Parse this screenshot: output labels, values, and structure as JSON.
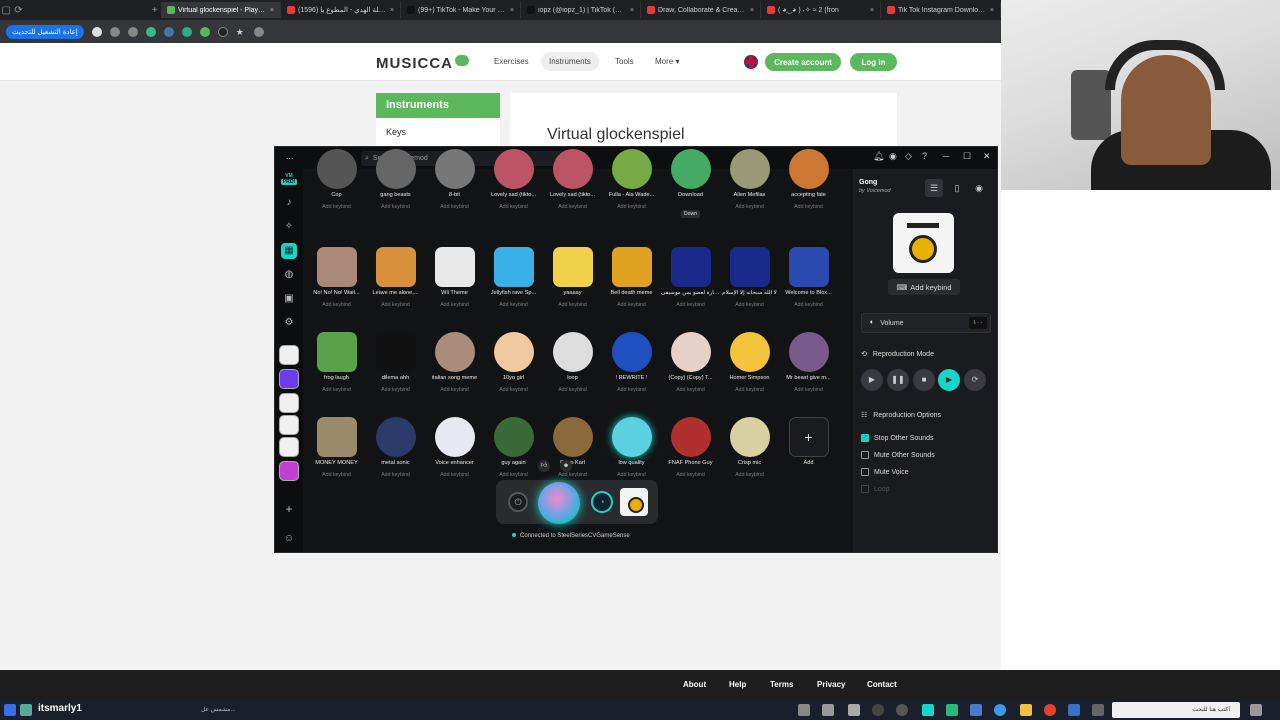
{
  "browser": {
    "tabs": [
      {
        "label": "Virtual glockenspiel - Play gloc",
        "active": true,
        "color": "#5cb85c"
      },
      {
        "label": "شيلة الهدي - المطوع يا (1596)",
        "active": false,
        "color": "#e53935"
      },
      {
        "label": "(99+) TikTok - Make Your Day",
        "active": false,
        "color": "#111111"
      },
      {
        "label": "iopz (@iopz_1) | TikTok (+99)",
        "active": false,
        "color": "#111111"
      },
      {
        "label": "Draw, Collaborate & Create wit",
        "active": false,
        "color": "#e53935"
      },
      {
        "label": "( ◕‿◕ ) ˖✧ ≈ 2 (fron",
        "active": false,
        "color": "#e53935"
      },
      {
        "label": "Tik Tok Instagram Downloade",
        "active": false,
        "color": "#e53935"
      }
    ],
    "reload_label": "إعادة التشغيل للتحديث"
  },
  "site": {
    "logo": "MUSICCA",
    "nav": {
      "exercises": "Exercises",
      "instruments": "Instruments",
      "tools": "Tools",
      "more": "More ▾"
    },
    "create_account": "Create account",
    "login": "Log in",
    "sidebar_heading": "Instruments",
    "sidebar_item": "Keys",
    "page_title": "Virtual glockenspiel",
    "footer": {
      "about": "About",
      "help": "Help",
      "terms": "Terms",
      "privacy": "Privacy",
      "contact": "Contact"
    }
  },
  "voicemod": {
    "menu": "...",
    "search_placeholder": "Search Voicemod",
    "pro_badge": "PRO!",
    "sounds": [
      {
        "name": "Cop",
        "keybind": "Add keybind",
        "color": "#555"
      },
      {
        "name": "gang beasts",
        "keybind": "Add keybind",
        "color": "#666"
      },
      {
        "name": "8-bit",
        "keybind": "Add keybind",
        "color": "#777"
      },
      {
        "name": "Lovely sad (tikto...",
        "keybind": "Add keybind",
        "color": "#b56"
      },
      {
        "name": "Lovely sad (tikto...",
        "keybind": "Add keybind",
        "color": "#b56"
      },
      {
        "name": "Fulla - Ala Wade...",
        "keybind": "Add keybind",
        "color": "#7a4"
      },
      {
        "name": "Download",
        "keybind": "Down",
        "color": "#4a6"
      },
      {
        "name": "Alien Mefilas",
        "keybind": "Add keybind",
        "color": "#997"
      },
      {
        "name": "accepting fate",
        "keybind": "Add keybind",
        "color": "#c73"
      },
      {
        "name": "No! No! No! Wait...",
        "keybind": "Add keybind",
        "color": "#a87"
      },
      {
        "name": "Leave me alone,...",
        "keybind": "Add keybind",
        "color": "#d8913a"
      },
      {
        "name": "Wii Theme",
        "keybind": "Add keybind",
        "color": "#e8e8e8"
      },
      {
        "name": "Jellyfish rave Sp...",
        "keybind": "Add keybind",
        "color": "#3ab0e8"
      },
      {
        "name": "yaaaay",
        "keybind": "Add keybind",
        "color": "#f1d24a"
      },
      {
        "name": "Bell death meme",
        "keybind": "Add keybind",
        "color": "#e0a020"
      },
      {
        "name": "ختم شارة لعضو بمن موسيقى",
        "keybind": "Add keybind",
        "color": "#1a2a8a"
      },
      {
        "name": "لا الله سبحانه إلا الإسلام",
        "keybind": "Add keybind",
        "color": "#1a2a8a"
      },
      {
        "name": "Welcome to Blox...",
        "keybind": "Add keybind",
        "color": "#2a4ab0"
      },
      {
        "name": "frog laugh",
        "keybind": "Add keybind",
        "color": "#5aa24a"
      },
      {
        "name": "dilema ahh",
        "keybind": "Add keybind",
        "color": "#111"
      },
      {
        "name": "italian song meme",
        "keybind": "Add keybind",
        "color": "#a98c7a"
      },
      {
        "name": "10yo girl",
        "keybind": "Add keybind",
        "color": "#f1c9a0"
      },
      {
        "name": "loop",
        "keybind": "Add keybind",
        "color": "#ddd"
      },
      {
        "name": "! REWRITE !",
        "keybind": "Add keybind",
        "color": "#2050c0"
      },
      {
        "name": "(Copy) (Copy) T...",
        "keybind": "Add keybind",
        "color": "#e7d0c8"
      },
      {
        "name": "Homer Simpson",
        "keybind": "Add keybind",
        "color": "#f3c43b"
      },
      {
        "name": "Mr beast give m...",
        "keybind": "Add keybind",
        "color": "#7a5a8a"
      },
      {
        "name": "MONEY MONEY",
        "keybind": "Add keybind",
        "color": "#9a8a6a"
      },
      {
        "name": "metal sonic",
        "keybind": "Add keybind",
        "color": "#2a3a6a"
      },
      {
        "name": "Voice enhancer",
        "keybind": "Add keybind",
        "color": "#e8e8f0"
      },
      {
        "name": "guy again",
        "keybind": "Add keybind",
        "color": "#3a6a3a"
      },
      {
        "name": "Deep Karl",
        "keybind": "Add keybind",
        "color": "#8a6a3a"
      },
      {
        "name": "low quality",
        "keybind": "Add keybind",
        "color": "#5ad0e0"
      },
      {
        "name": "FNAF Phone Guy",
        "keybind": "Add keybind",
        "color": "#b03030"
      },
      {
        "name": "Crisp mic",
        "keybind": "Add keybind",
        "color": "#d8d0a0"
      },
      {
        "name": "Add",
        "keybind": "",
        "color": "#1a1b1e"
      }
    ],
    "connected": "Connected to SteelSeriesCVGameSense",
    "selected": {
      "title": "Gong",
      "by": "by Voicemod",
      "add_keybind": "Add keybind",
      "volume_label": "Volume",
      "volume_value": "١٠٠",
      "reproduction_mode": "Reproduction Mode",
      "reproduction_options": "Reproduction Options",
      "options": [
        {
          "label": "Stop Other Sounds",
          "checked": true
        },
        {
          "label": "Mute Other Sounds",
          "checked": false
        },
        {
          "label": "Mute Voice",
          "checked": false
        },
        {
          "label": "Loop",
          "checked": false,
          "disabled": true
        }
      ]
    },
    "accent": "#17d6c8"
  },
  "taskbar": {
    "user": "itsmarly1",
    "ticker": "مشمس عل...",
    "search_placeholder": "اكتب هنا للبحث"
  }
}
